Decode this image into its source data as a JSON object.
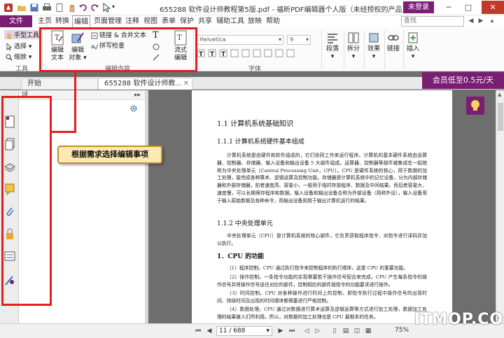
{
  "window": {
    "title": "655288 软件设计师教程第5版.pdf - 福昕PDF编辑器个人版（未经授权的产品）",
    "login_label": "未登录"
  },
  "menubar": {
    "file_label": "文件",
    "items": [
      "主页",
      "转换",
      "编辑",
      "页面管理",
      "注释",
      "视图",
      "表单",
      "保护",
      "共享",
      "辅助工具",
      "放映",
      "帮助"
    ],
    "active": "编辑",
    "search_placeholder": "查找"
  },
  "ribbon": {
    "tools_group": {
      "label": "工具",
      "hand_tool": "手型工具",
      "select": "选择",
      "zoom": "缩放"
    },
    "edit_group": {
      "label": "编辑内容",
      "edit_text": [
        "编辑",
        "文本"
      ],
      "edit_object": [
        "编辑",
        "对象"
      ],
      "link_merge": "链接 & 合并文本",
      "spell_check": "拼写检查",
      "flow_edit": [
        "流式",
        "编辑"
      ]
    },
    "font_group": {
      "label": "字体",
      "font_name": "Helvetica",
      "font_size": "9"
    },
    "paragraph": "段落",
    "split": "拆分",
    "effect": "效果",
    "link": "链接",
    "insert": "插入"
  },
  "tabs": {
    "start": "开始",
    "doc": "655288 软件设计师教..."
  },
  "promo": "会员低至0.5元/天",
  "panel": {
    "header": "域"
  },
  "annotation": {
    "callout": "根据需求选择编辑事项"
  },
  "document": {
    "h1": "1.1   计算机系统基础知识",
    "h2a": "1.1.1   计算机系统硬件基本组成",
    "p1": "计算机系统是由硬件和软件组成的，它们协同工作来运行程序。计算机的基本硬件系统由运算器、控制器、存储器、输入设备和输出设备 5 大部件组成。运算器、控制器等部件被集成在一起统称为中央处理单元（Central Processing Unit，CPU）。CPU 是硬件系统的核心，用于数据的加工处理，能完成各种算术、逻辑运算及控制功能。存储器是计算机系统中的记忆设备，分为内部存储器和外部存储器。前者速度高、容量小，一般用于临时存放程序、数据及中间结果。而后者容量大、速度慢，可以长期保存程序和数据。输入设备和输出设备合称为外部设备（简称外设），输入设备用于输入原始数据及各种命令，而输出设备则用于输出计算机运行的结果。",
    "h2b": "1.1.2   中央处理单元",
    "p2": "中央处理单元（CPU）是计算机系统的核心部件，它负责获取程序指令、对指令进行译码并加以执行。",
    "h3": "1．CPU 的功能",
    "p3": "（1）程序控制。CPU 通过执行指令来控制程序的执行顺序，这是 CPU 的重要功能。",
    "p4": "（2）操作控制。一条指令功能的实现需要若干操作信号配合来完成，CPU 产生每条指令的操作信号并将操作信号送往对应的部件，控制相应的部件按指令的功能要求进行操作。",
    "p5": "（3）时间控制。CPU 对各种操作进行时间上的控制，即指令执行过程中操作信号的出现时间、持续时间及出现的时间顺序都需要进行严格控制。",
    "p6": "（4）数据处理。CPU 通过对数据进行算术运算及逻辑运算等方式进行加工处理，数据加工处理的结果被人们所利用。所以，对数据的加工处理也是 CPU 最根本的任务。"
  },
  "statusbar": {
    "page_indicator": "11 / 688",
    "zoom": "75%"
  },
  "watermark": "ITMOP.COM",
  "colors": {
    "brand": "#7a1e74",
    "annotation_red": "#e41e1e",
    "callout_bg": "#fde9b4"
  }
}
